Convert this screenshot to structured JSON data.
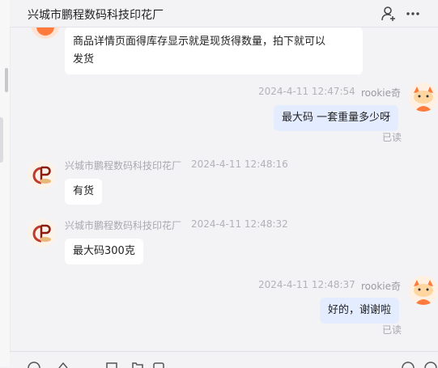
{
  "header": {
    "title": "兴城市鹏程数码科技印花厂"
  },
  "messages": [
    {
      "side": "left",
      "text_line1": "商品详情页面得库存显示就是现货得数量，拍下就可以",
      "text_line2": "发货"
    },
    {
      "side": "right",
      "time": "2024-4-11 12:47:54",
      "sender": "rookie奇",
      "text": "最大码 一套重量多少呀",
      "status": "已读"
    },
    {
      "side": "left",
      "sender": "兴城市鹏程数码科技印花厂",
      "time": "2024-4-11 12:48:16",
      "text": "有货"
    },
    {
      "side": "left",
      "sender": "兴城市鹏程数码科技印花厂",
      "time": "2024-4-11 12:48:32",
      "text": "最大码300克"
    },
    {
      "side": "right",
      "time": "2024-4-11 12:48:37",
      "sender": "rookie奇",
      "text": "好的，谢谢啦",
      "status": "已读"
    }
  ],
  "icons": {
    "add_user": "add-user-icon",
    "more": "more-icon",
    "shop_logo": "cp-logo",
    "user_avatar": "cartoon-avatar"
  },
  "colors": {
    "background": "#f3f3f5",
    "bubble_left": "#ffffff",
    "bubble_right": "#e4ecff",
    "avatar_orange": "#ff7a3d"
  }
}
